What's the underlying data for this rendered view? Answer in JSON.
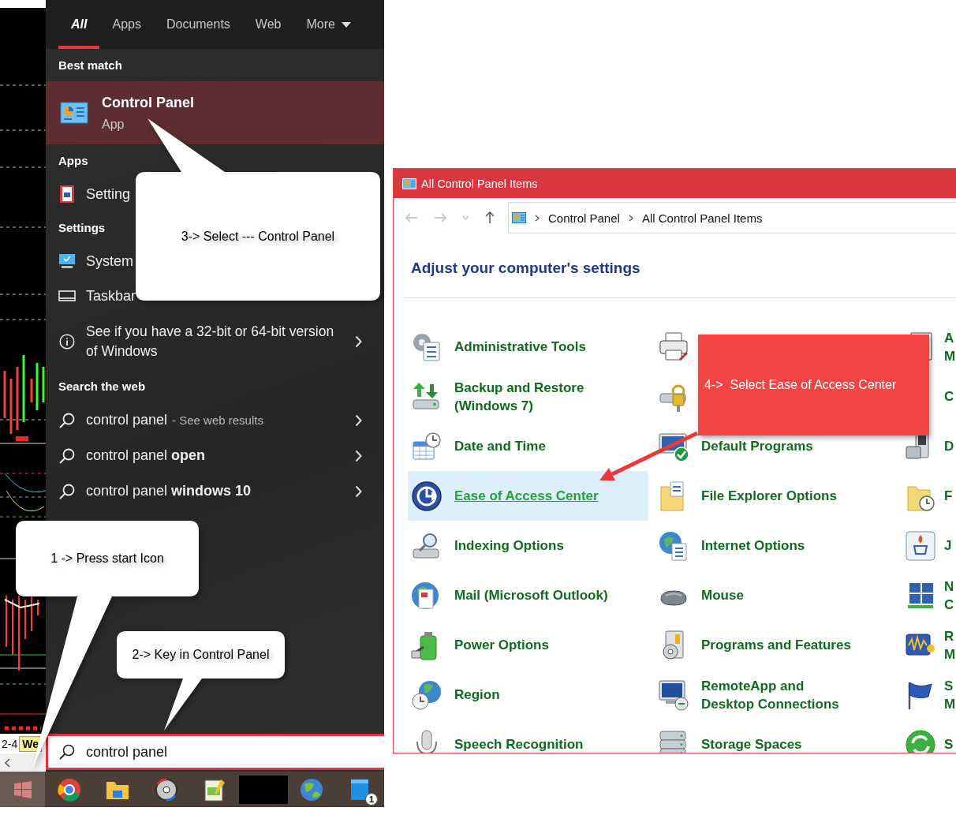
{
  "start_menu": {
    "tabs": [
      {
        "label": "All",
        "selected": true
      },
      {
        "label": "Apps",
        "selected": false
      },
      {
        "label": "Documents",
        "selected": false
      },
      {
        "label": "Web",
        "selected": false
      },
      {
        "label": "More",
        "selected": false,
        "dropdown": true
      }
    ],
    "sections": [
      {
        "header": "Best match",
        "items": [
          {
            "kind": "best",
            "title": "Control Panel",
            "subtitle": "App",
            "selected": true
          }
        ]
      },
      {
        "header": "Apps",
        "items": [
          {
            "kind": "entry",
            "text": "Setting"
          }
        ]
      },
      {
        "header": "Settings",
        "items": [
          {
            "kind": "entry",
            "text": "System"
          },
          {
            "kind": "entry",
            "text": "Taskbar"
          },
          {
            "kind": "info",
            "text": "See if you have a 32-bit or 64-bit version of Windows",
            "arrow": true
          }
        ]
      },
      {
        "header": "Search the web",
        "items": [
          {
            "kind": "web",
            "text": "control panel",
            "hint": "- See web results",
            "arrow": true
          },
          {
            "kind": "web",
            "text": "control panel **open**",
            "arrow": true
          },
          {
            "kind": "web",
            "text": "control panel **windows 10**",
            "arrow": true
          }
        ]
      }
    ],
    "search": {
      "value": "control panel"
    }
  },
  "chart": {
    "labels": [
      "2-4",
      "We"
    ]
  },
  "taskbar": {
    "badge": "1"
  },
  "window": {
    "title": "All Control Panel Items",
    "breadcrumb": [
      "Control Panel",
      "All Control Panel Items"
    ],
    "heading": "Adjust your computer's settings",
    "columns": [
      {
        "items": [
          {
            "label": "Administrative Tools",
            "selected": false
          },
          {
            "label": "Backup and Restore\n(Windows 7)",
            "selected": false
          },
          {
            "label": "Date and Time",
            "selected": false
          },
          {
            "label": "Ease of Access Center",
            "selected": true
          },
          {
            "label": "Indexing Options",
            "selected": false
          },
          {
            "label": "Mail (Microsoft Outlook)",
            "selected": false
          },
          {
            "label": "Power Options",
            "selected": false
          },
          {
            "label": "Region",
            "selected": false
          },
          {
            "label": "Speech Recognition",
            "selected": false
          }
        ]
      },
      {
        "items": [
          {
            "selected": false
          },
          {
            "selected": false
          },
          {
            "label": "Default Programs",
            "selected": false
          },
          {
            "label": "File Explorer Options",
            "selected": false
          },
          {
            "label": "Internet Options",
            "selected": false
          },
          {
            "label": "Mouse",
            "selected": false
          },
          {
            "label": "Programs and Features",
            "selected": false
          },
          {
            "label": "RemoteApp and\nDesktop Connections",
            "selected": false
          },
          {
            "label": "Storage Spaces",
            "selected": false
          }
        ]
      },
      {
        "items": [
          {
            "label": "A\nM",
            "selected": false
          },
          {
            "label": "C",
            "selected": false
          },
          {
            "label": "D",
            "selected": false
          },
          {
            "label": "F",
            "selected": false
          },
          {
            "label": "J",
            "selected": false
          },
          {
            "label": "N\nC",
            "selected": false
          },
          {
            "label": "R\nM",
            "selected": false
          },
          {
            "label": "S\nM",
            "selected": false
          },
          {
            "label": "S",
            "selected": false
          }
        ]
      }
    ]
  },
  "callouts": [
    {
      "kind": "bubble",
      "text": "3-> Select --- Control Panel"
    },
    {
      "kind": "bubble",
      "text": "1 -> Press start Icon"
    },
    {
      "kind": "bubble",
      "text": "2-> Key in Control Panel"
    },
    {
      "kind": "note",
      "text": "4->  Select Ease of Access Center"
    }
  ]
}
